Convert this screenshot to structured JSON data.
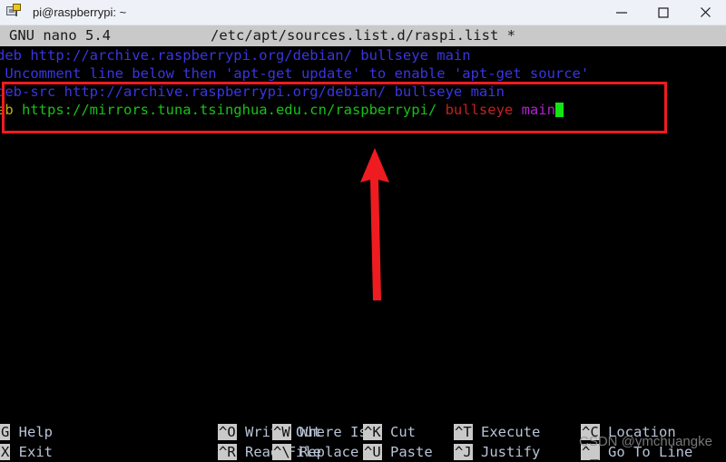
{
  "window": {
    "title": "pi@raspberrypi: ~",
    "icon": "putty-terminal-icon",
    "minimize_label": "—",
    "maximize_label": "□",
    "close_label": "✕"
  },
  "nano": {
    "version_label": "GNU nano 5.4",
    "filename": "/etc/apt/sources.list.d/raspi.list *",
    "lines": [
      {
        "id": "line-1",
        "segments": [
          {
            "text": "deb http://archive.raspberrypi.org/debian/ bullseye main",
            "color": "comment"
          }
        ]
      },
      {
        "id": "line-2",
        "segments": [
          {
            "text": " Uncomment line below then 'apt-get update' to enable 'apt-get source'",
            "color": "comment"
          }
        ]
      },
      {
        "id": "line-3",
        "segments": [
          {
            "text": "deb-src http://archive.raspberrypi.org/debian/ bullseye main",
            "color": "comment"
          }
        ]
      },
      {
        "id": "line-4",
        "segments": [
          {
            "text": "eb ",
            "color": "yellow"
          },
          {
            "text": "https://mirrors.tuna.tsinghua.edu.cn/raspberrypi/ ",
            "color": "green"
          },
          {
            "text": "bullseye",
            "color": "red"
          },
          {
            "text": " ",
            "color": "green"
          },
          {
            "text": "main",
            "color": "magenta"
          }
        ],
        "cursor": true
      }
    ],
    "shortcuts_row1": [
      {
        "key": "G",
        "label": "Help"
      },
      {
        "key": "^O",
        "label": "Write Out"
      },
      {
        "key": "^W",
        "label": "Where Is"
      },
      {
        "key": "^K",
        "label": "Cut"
      },
      {
        "key": "^T",
        "label": "Execute"
      },
      {
        "key": "^C",
        "label": "Location"
      }
    ],
    "shortcuts_row2": [
      {
        "key": "X",
        "label": "Exit"
      },
      {
        "key": "^R",
        "label": "Read File"
      },
      {
        "key": "^\\",
        "label": "Replace"
      },
      {
        "key": "^U",
        "label": "Paste"
      },
      {
        "key": "^J",
        "label": "Justify"
      },
      {
        "key": "^_",
        "label": "Go To Line"
      }
    ]
  },
  "annotations": {
    "highlight_box": "red-rectangle-around-lines-3-and-4",
    "arrow": "red-up-arrow-pointing-to-mirror-line",
    "arrow_color": "#ee1c20",
    "box_color": "#ee1c20"
  },
  "watermark": {
    "text": "CSDN @ymchuangke"
  },
  "colors": {
    "terminal_background": "#000000",
    "comment_blue": "#3a35e0",
    "url_green": "#17c117",
    "suite_red": "#c42020",
    "component_magenta": "#b31fd1",
    "deb_yellow": "#c2b100",
    "cursor_green": "#12e512",
    "status_bar_gray": "#c9c9c9",
    "titlebar_background": "#eef2f8"
  }
}
